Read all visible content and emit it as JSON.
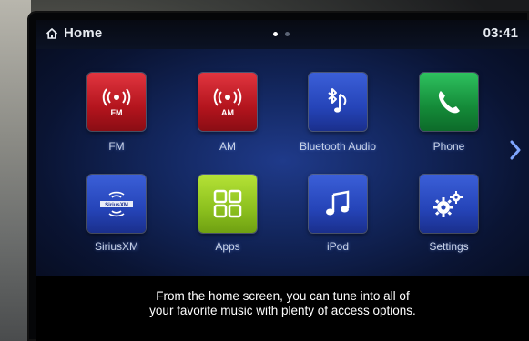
{
  "statusbar": {
    "title": "Home",
    "time": "03:41",
    "page_dots": 2,
    "active_dot": 0
  },
  "apps": [
    {
      "label": "FM",
      "icon": "fm-radio-icon",
      "badge": "FM",
      "color": "#c41a24"
    },
    {
      "label": "AM",
      "icon": "am-radio-icon",
      "badge": "AM",
      "color": "#c41a24"
    },
    {
      "label": "Bluetooth Audio",
      "icon": "bluetooth-music-icon",
      "color": "#2544b8"
    },
    {
      "label": "Phone",
      "icon": "phone-icon",
      "color": "#148a38"
    },
    {
      "label": "SiriusXM",
      "icon": "siriusxm-icon",
      "badge": "SiriusXM",
      "color": "#2544b8"
    },
    {
      "label": "Apps",
      "icon": "apps-grid-icon",
      "color": "#8cc01e"
    },
    {
      "label": "iPod",
      "icon": "music-note-icon",
      "color": "#2544b8"
    },
    {
      "label": "Settings",
      "icon": "gear-icon",
      "color": "#2544b8"
    }
  ],
  "navigation": {
    "next_icon": "chevron-right-icon"
  },
  "caption": {
    "line1": "From the home screen, you can tune into all of",
    "line2": "your favorite music with plenty of access options."
  }
}
